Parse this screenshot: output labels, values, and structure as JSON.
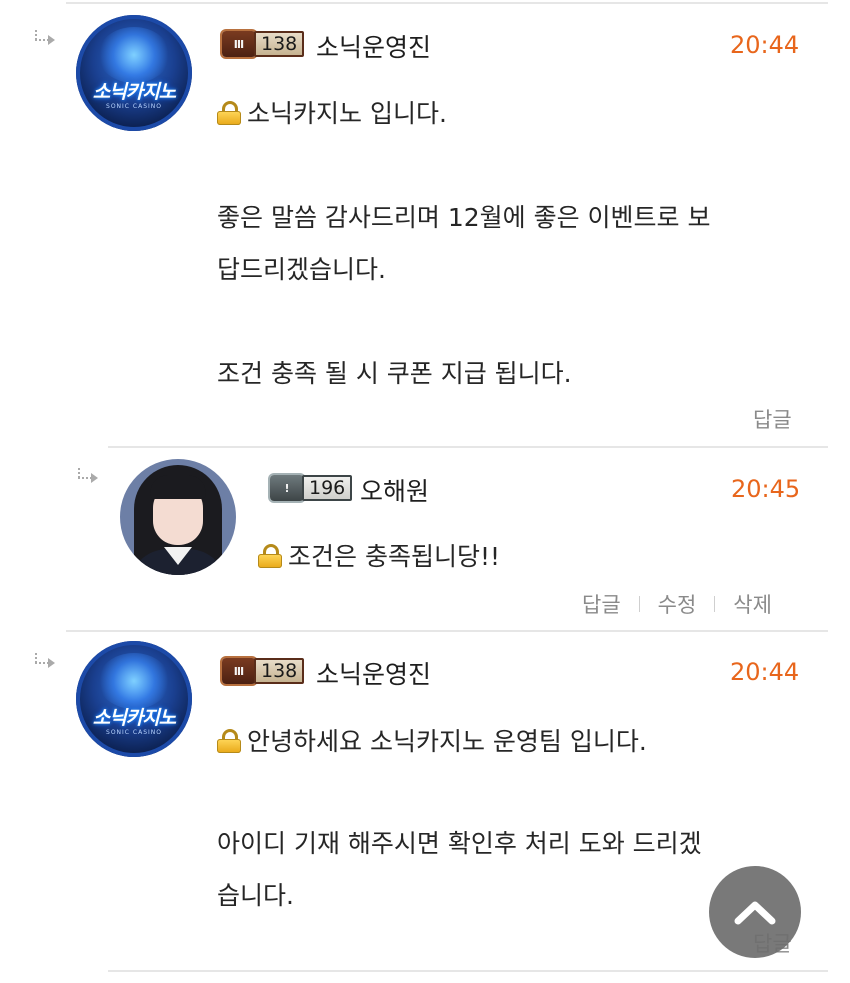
{
  "comments": [
    {
      "author": "소닉운영진",
      "level": "138",
      "time": "20:44",
      "avatar_text": "소닉카지노",
      "avatar_sub": "SONIC CASINO",
      "lines": [
        "소닉카지노 입니다.",
        "좋은 말씀 감사드리며 12월에 좋은 이벤트로 보",
        "답드리겠습니다.",
        "조건 충족 될 시 쿠폰 지급 됩니다."
      ],
      "reply_label": "답글"
    },
    {
      "author": "오해원",
      "level": "196",
      "time": "20:45",
      "lines": [
        "조건은 충족됩니당!!"
      ],
      "reply_label": "답글",
      "edit_label": "수정",
      "delete_label": "삭제"
    },
    {
      "author": "소닉운영진",
      "level": "138",
      "time": "20:44",
      "avatar_text": "소닉카지노",
      "avatar_sub": "SONIC CASINO",
      "lines": [
        "안녕하세요 소닉카지노 운영팀 입니다.",
        "아이디 기재 해주시면 확인후 처리 도와 드리겠",
        "습니다."
      ],
      "reply_label": "답글"
    }
  ],
  "icons": {
    "lock": "lock-icon",
    "reply_arrow": "reply-arrow-icon",
    "scroll_top": "chevron-up-icon"
  },
  "colors": {
    "time": "#e8661c",
    "divider": "#e6e6e6",
    "action_text": "#8a8a8a",
    "fab": "#6e6e6e"
  }
}
